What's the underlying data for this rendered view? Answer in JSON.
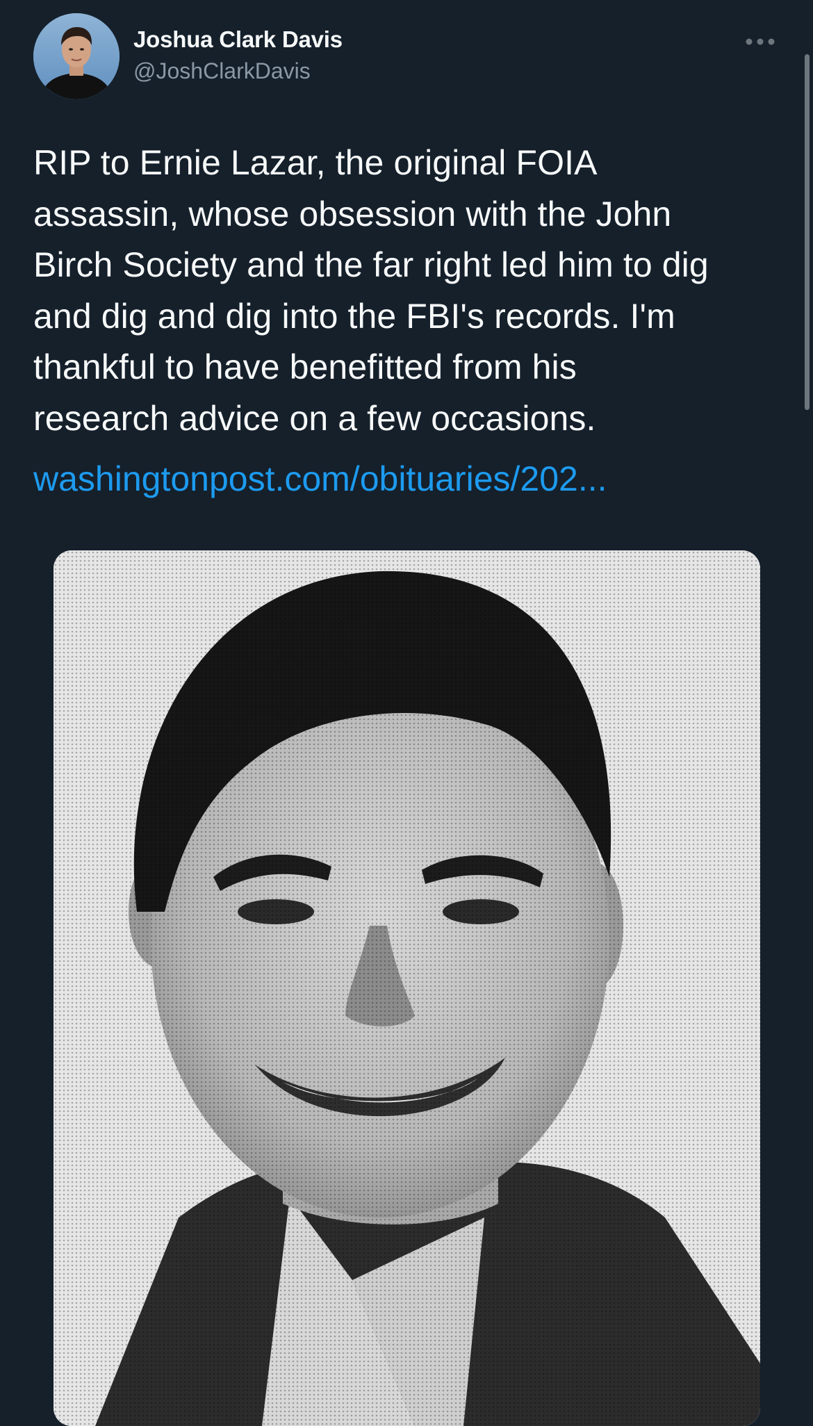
{
  "tweet": {
    "author": {
      "display_name": "Joshua Clark Davis",
      "handle": "@JoshClarkDavis"
    },
    "text_lines": [
      "RIP to Ernie Lazar, the original FOIA",
      "assassin, whose obsession with the John",
      "Birch Society and the far right led him to dig",
      "and dig and dig into the FBI's records. I'm",
      "thankful to have benefitted from his",
      "research advice on a few occasions."
    ],
    "link_text": "washingtonpost.com/obituaries/202...",
    "more_icon": "more-horizontal-icon",
    "media_description_icon": "photo"
  },
  "colors": {
    "background": "#15202b",
    "text_primary": "#f7f9f9",
    "text_secondary": "#8b98a5",
    "link": "#1d9bf0"
  }
}
